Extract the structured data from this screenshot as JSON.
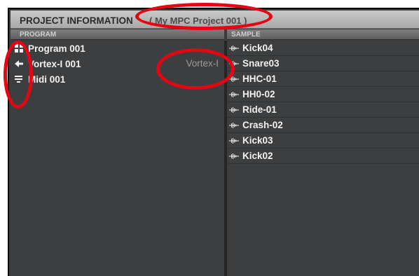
{
  "header": {
    "title": "PROJECT INFORMATION",
    "project_name": "( My MPC Project 001 )"
  },
  "columns": {
    "program": "PROGRAM",
    "sample": "SAMPLE"
  },
  "programs": [
    {
      "icon": "drum-grid-icon",
      "name": "Program 001",
      "subtitle": ""
    },
    {
      "icon": "plugin-arrow-icon",
      "name": "Vortex-I 001",
      "subtitle": "Vortex-I"
    },
    {
      "icon": "midi-lines-icon",
      "name": "Midi 001",
      "subtitle": ""
    }
  ],
  "samples": [
    {
      "icon": "waveform-icon",
      "name": "Kick04"
    },
    {
      "icon": "waveform-icon",
      "name": "Snare03"
    },
    {
      "icon": "waveform-icon",
      "name": "HHC-01"
    },
    {
      "icon": "waveform-icon",
      "name": "HH0-02"
    },
    {
      "icon": "waveform-icon",
      "name": "Ride-01"
    },
    {
      "icon": "waveform-icon",
      "name": "Crash-02"
    },
    {
      "icon": "waveform-icon",
      "name": "Kick03"
    },
    {
      "icon": "waveform-icon",
      "name": "Kick02"
    }
  ],
  "colors": {
    "panel_bg": "#3d3e3f",
    "title_bar": "#b8b8b8",
    "annotation": "#e30613",
    "row_text": "#f2f2f2",
    "subtitle_text": "#9b9b9b"
  }
}
